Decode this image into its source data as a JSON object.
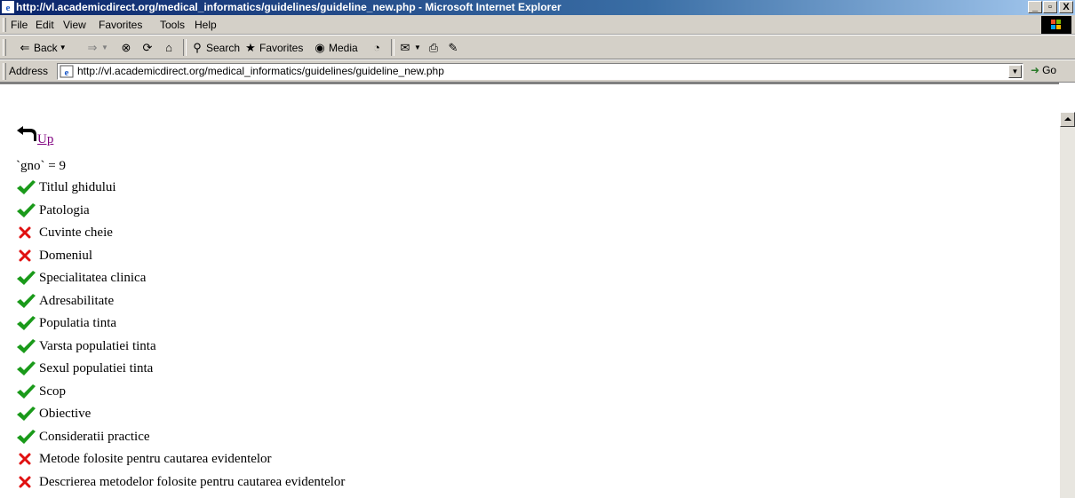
{
  "window": {
    "title": "http://vl.academicdirect.org/medical_informatics/guidelines/guideline_new.php - Microsoft Internet Explorer",
    "buttons": [
      "_",
      "▫",
      "X"
    ]
  },
  "menu": [
    "File",
    "Edit",
    "View",
    "Favorites",
    "Tools",
    "Help"
  ],
  "toolbar": {
    "back": "Back",
    "search": "Search",
    "favorites": "Favorites",
    "media": "Media"
  },
  "address": {
    "label": "Address",
    "url": "http://vl.academicdirect.org/medical_informatics/guidelines/guideline_new.php",
    "go": "Go"
  },
  "page": {
    "up_link": "Up",
    "gno_line": "`gno` = 9",
    "items": [
      {
        "status": "ok",
        "label": "Titlul ghidului"
      },
      {
        "status": "ok",
        "label": "Patologia"
      },
      {
        "status": "missing",
        "label": "Cuvinte cheie"
      },
      {
        "status": "missing",
        "label": "Domeniul"
      },
      {
        "status": "ok",
        "label": "Specialitatea clinica"
      },
      {
        "status": "ok",
        "label": "Adresabilitate"
      },
      {
        "status": "ok",
        "label": "Populatia tinta"
      },
      {
        "status": "ok",
        "label": "Varsta populatiei tinta"
      },
      {
        "status": "ok",
        "label": "Sexul populatiei tinta"
      },
      {
        "status": "ok",
        "label": "Scop"
      },
      {
        "status": "ok",
        "label": "Obiective"
      },
      {
        "status": "ok",
        "label": "Consideratii practice"
      },
      {
        "status": "missing",
        "label": "Metode folosite pentru cautarea evidentelor"
      },
      {
        "status": "missing",
        "label": "Descrierea metodelor folosite pentru cautarea evidentelor"
      }
    ]
  },
  "colors": {
    "ok": "#1a9a1a",
    "missing": "#e01010",
    "visited_link": "#800080"
  }
}
